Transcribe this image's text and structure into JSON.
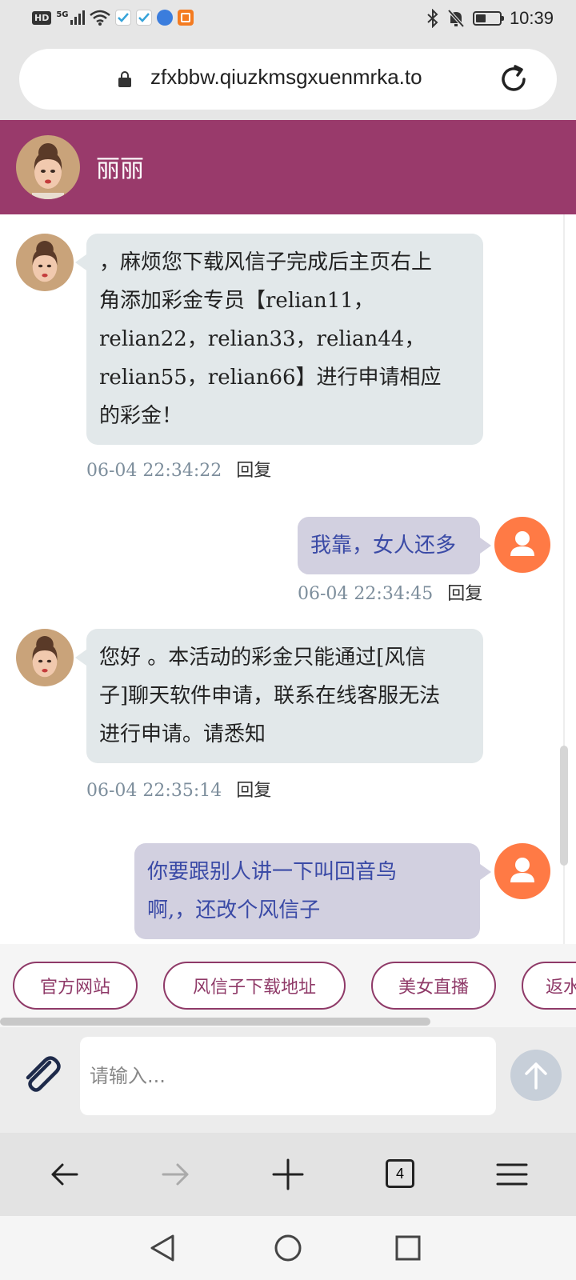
{
  "status_bar": {
    "left_badges": {
      "hd": "HD",
      "network": "5G"
    },
    "time": "10:39",
    "icons": [
      "hd-icon",
      "signal-5g-icon",
      "wifi-icon",
      "app-icon-1",
      "app-icon-2",
      "app-icon-3",
      "app-icon-4",
      "bluetooth-icon",
      "mute-icon",
      "battery-icon"
    ]
  },
  "browser": {
    "url": "zfxbbw.qiuzkmsgxuenmrka.to",
    "tab_count": "4"
  },
  "chat": {
    "contact_name": "丽丽",
    "messages": [
      {
        "side": "in",
        "lines": [
          "，麻烦您下载风信子完成后主页右上",
          "角添加彩金专员【relian11，",
          "relian22，relian33，relian44，",
          "relian55，relian66】进行申请相应",
          "的彩金！"
        ],
        "time": "06-04 22:34:22",
        "reply": "回复"
      },
      {
        "side": "out",
        "lines": [
          "我靠，女人还多"
        ],
        "time": "06-04 22:34:45",
        "reply": "回复"
      },
      {
        "side": "in",
        "lines": [
          "您好 。本活动的彩金只能通过[风信",
          "子]聊天软件申请，联系在线客服无法",
          "进行申请。请悉知"
        ],
        "time": "06-04 22:35:14",
        "reply": "回复"
      },
      {
        "side": "out",
        "lines": [
          "你要跟别人讲一下叫回音鸟",
          "啊,，还改个风信子"
        ]
      }
    ]
  },
  "quick_links": [
    "官方网站",
    "风信子下载地址",
    "美女直播",
    "返水"
  ],
  "input": {
    "placeholder": "请输入..."
  },
  "colors": {
    "header": "#993a6b",
    "incoming_bubble": "#e2e8ea",
    "outgoing_bubble": "#d2d0e0",
    "user_avatar": "#ff7a45",
    "link_border": "#8f3a68"
  }
}
